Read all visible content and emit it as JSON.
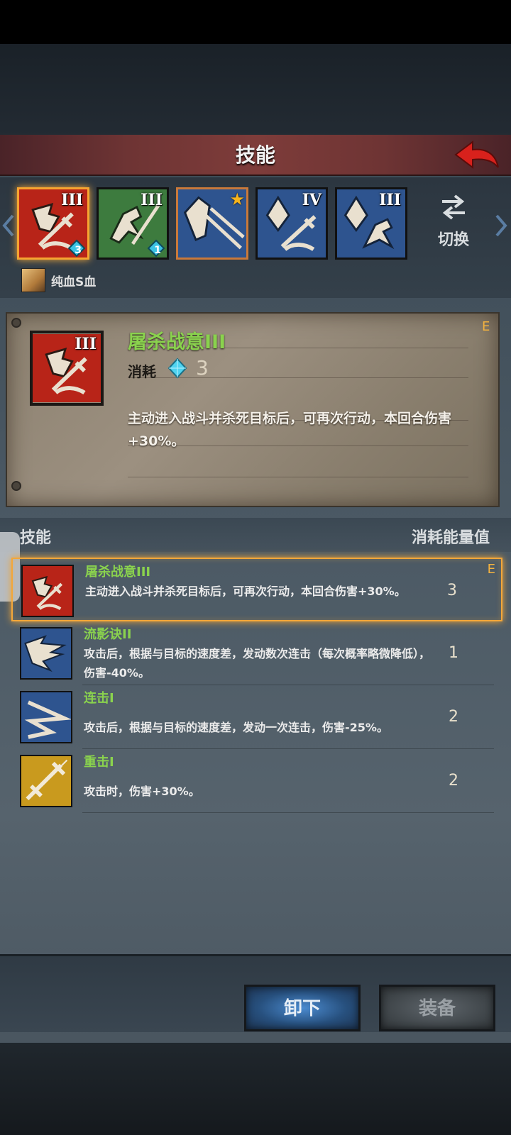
{
  "header": {
    "title": "技能",
    "back_icon": "red-back-arrow-icon"
  },
  "slots": [
    {
      "rank": "III",
      "badge": "3",
      "color": "#b82418",
      "icon": "fist-sword-icon",
      "selected": true
    },
    {
      "rank": "III",
      "badge": "1",
      "color": "#3d7b3e",
      "icon": "horse-spear-icon"
    },
    {
      "rank": "",
      "badge": "",
      "color": "#2e548f",
      "icon": "shield-thrust-icon",
      "star": true
    },
    {
      "rank": "IV",
      "badge": "",
      "color": "#2e548f",
      "icon": "crystal-sword-icon"
    },
    {
      "rank": "III",
      "badge": "",
      "color": "#2e548f",
      "icon": "crystal-horse-icon"
    }
  ],
  "switch": {
    "label": "切换",
    "icon": "swap-arrows-icon"
  },
  "hero": {
    "label": "纯血S血"
  },
  "detail": {
    "name": "屠杀战意III",
    "grade": "E",
    "cost_label": "消耗",
    "cost_value": "3",
    "description": "主动进入战斗并杀死目标后，可再次行动，本回合伤害+30%。"
  },
  "list": {
    "header_left": "技能",
    "header_right": "消耗能量值",
    "items": [
      {
        "name": "屠杀战意III",
        "desc": "主动进入战斗并杀死目标后，可再次行动，本回合伤害+30%。",
        "cost": "3",
        "grade": "E",
        "color": "#b82418"
      },
      {
        "name": "流影诀II",
        "desc": "攻击后，根据与目标的速度差，发动数次连击（每次概率略微降低），伤害-40%。",
        "cost": "1",
        "grade": "",
        "color": "#2e548f"
      },
      {
        "name": "连击I",
        "desc": "攻击后，根据与目标的速度差，发动一次连击，伤害-25%。",
        "cost": "2",
        "grade": "",
        "color": "#2e548f"
      },
      {
        "name": "重击I",
        "desc": "攻击时，伤害+30%。",
        "cost": "2",
        "grade": "",
        "color": "#c99a1e"
      }
    ]
  },
  "buttons": {
    "unequip": "卸下",
    "equip": "装备"
  }
}
